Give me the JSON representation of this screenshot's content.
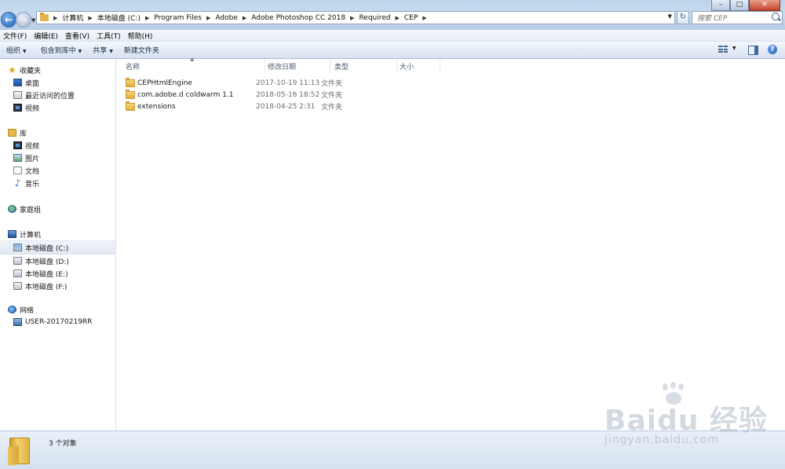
{
  "window": {
    "minimize_label": "–",
    "maximize_label": "□",
    "close_label": "✕"
  },
  "address_bar": {
    "breadcrumbs": [
      {
        "label": "计算机"
      },
      {
        "label": "本地磁盘 (C:)"
      },
      {
        "label": "Program Files"
      },
      {
        "label": "Adobe"
      },
      {
        "label": "Adobe Photoshop CC 2018"
      },
      {
        "label": "Required"
      },
      {
        "label": "CEP"
      }
    ]
  },
  "search": {
    "placeholder": "搜索 CEP"
  },
  "menu": {
    "items": [
      {
        "label": "文件(F)"
      },
      {
        "label": "编辑(E)"
      },
      {
        "label": "查看(V)"
      },
      {
        "label": "工具(T)"
      },
      {
        "label": "帮助(H)"
      }
    ]
  },
  "toolbar": {
    "organize": "组织",
    "include_in_library": "包含到库中",
    "share": "共享",
    "new_folder": "新建文件夹"
  },
  "nav": {
    "favorites": {
      "label": "收藏夹",
      "items": [
        {
          "label": "桌面"
        },
        {
          "label": "最近访问的位置"
        },
        {
          "label": "视频"
        }
      ]
    },
    "libraries": {
      "label": "库",
      "items": [
        {
          "label": "视频"
        },
        {
          "label": "图片"
        },
        {
          "label": "文档"
        },
        {
          "label": "音乐"
        }
      ]
    },
    "homegroup": {
      "label": "家庭组"
    },
    "computer": {
      "label": "计算机",
      "items": [
        {
          "label": "本地磁盘 (C:)"
        },
        {
          "label": "本地磁盘 (D:)"
        },
        {
          "label": "本地磁盘 (E:)"
        },
        {
          "label": "本地磁盘 (F:)"
        }
      ]
    },
    "network": {
      "label": "网络",
      "items": [
        {
          "label": "USER-20170219RR"
        }
      ]
    }
  },
  "columns": {
    "name": "名称",
    "modified": "修改日期",
    "type": "类型",
    "size": "大小"
  },
  "files": [
    {
      "name": "CEPHtmlEngine",
      "modified": "2017-10-19 11:13",
      "type": "文件夹"
    },
    {
      "name": "com.adobe.d coldwarm 1.1",
      "modified": "2018-05-16 18:52",
      "type": "文件夹"
    },
    {
      "name": "extensions",
      "modified": "2018-04-25 2:31",
      "type": "文件夹"
    }
  ],
  "status": {
    "item_count": "3 个对象"
  },
  "watermark": {
    "logo": "Baidu 经验",
    "url": "jingyan.baidu.com"
  }
}
